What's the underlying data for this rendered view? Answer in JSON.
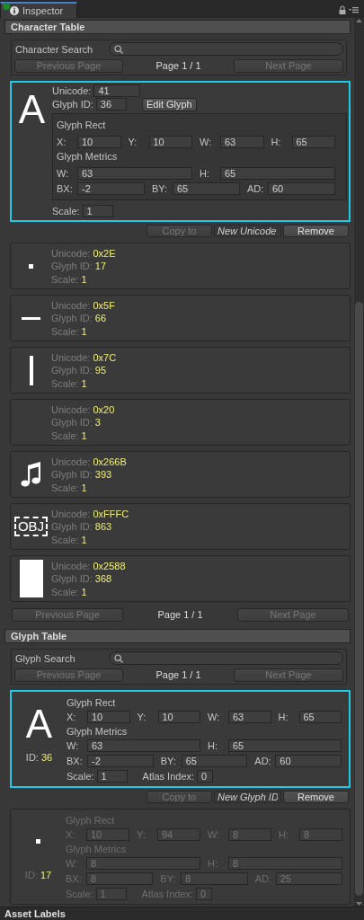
{
  "window": {
    "tab": {
      "label": "Inspector",
      "selected": true
    }
  },
  "character_table": {
    "title": "Character Table",
    "search": {
      "label": "Character Search"
    },
    "pager_top": {
      "previous": {
        "label": "Previous Page",
        "disabled": true
      },
      "page": "Page 1 / 1",
      "next": {
        "label": "Next Page",
        "disabled": true
      }
    },
    "characters": [
      {
        "selected": true,
        "preview": {
          "kind": "text",
          "text": "A"
        },
        "unicode_label": "Unicode:",
        "unicode": "41",
        "glyph_id_label": "Glyph ID:",
        "glyph_id": "36",
        "edit_button": "Edit Glyph",
        "glyph_rect": {
          "title": "Glyph Rect",
          "fields": [
            {
              "label": "X:",
              "value": "10"
            },
            {
              "label": "Y:",
              "value": "10"
            },
            {
              "label": "W:",
              "value": "63"
            },
            {
              "label": "H:",
              "value": "65"
            }
          ]
        },
        "glyph_metrics": {
          "title": "Glyph Metrics",
          "rows": [
            [
              {
                "label": "W:",
                "value": "63"
              },
              {
                "label": "H:",
                "value": "65"
              }
            ],
            [
              {
                "label": "BX:",
                "value": "-2"
              },
              {
                "label": "BY:",
                "value": "65"
              },
              {
                "label": "AD:",
                "value": "60"
              }
            ]
          ]
        },
        "scale_label": "Scale:",
        "scale": "1"
      },
      {
        "selected": false,
        "preview": {
          "kind": "dot"
        },
        "unicode_label": "Unicode:",
        "unicode": "0x2E",
        "glyph_id_label": "Glyph ID:",
        "glyph_id": "17",
        "scale_label": "Scale:",
        "scale": "1"
      },
      {
        "selected": false,
        "preview": {
          "kind": "underscore"
        },
        "unicode_label": "Unicode:",
        "unicode": "0x5F",
        "glyph_id_label": "Glyph ID:",
        "glyph_id": "66",
        "scale_label": "Scale:",
        "scale": "1"
      },
      {
        "selected": false,
        "preview": {
          "kind": "bar"
        },
        "unicode_label": "Unicode:",
        "unicode": "0x7C",
        "glyph_id_label": "Glyph ID:",
        "glyph_id": "95",
        "scale_label": "Scale:",
        "scale": "1"
      },
      {
        "selected": false,
        "preview": {
          "kind": "space"
        },
        "unicode_label": "Unicode:",
        "unicode": "0x20",
        "glyph_id_label": "Glyph ID:",
        "glyph_id": "3",
        "scale_label": "Scale:",
        "scale": "1"
      },
      {
        "selected": false,
        "preview": {
          "kind": "note"
        },
        "unicode_label": "Unicode:",
        "unicode": "0x266B",
        "glyph_id_label": "Glyph ID:",
        "glyph_id": "393",
        "scale_label": "Scale:",
        "scale": "1"
      },
      {
        "selected": false,
        "preview": {
          "kind": "object_box",
          "text": "OBJ"
        },
        "unicode_label": "Unicode:",
        "unicode": "0xFFFC",
        "glyph_id_label": "Glyph ID:",
        "glyph_id": "863",
        "scale_label": "Scale:",
        "scale": "1"
      },
      {
        "selected": false,
        "preview": {
          "kind": "block"
        },
        "unicode_label": "Unicode:",
        "unicode": "0x2588",
        "glyph_id_label": "Glyph ID:",
        "glyph_id": "368",
        "scale_label": "Scale:",
        "scale": "1"
      }
    ],
    "copy_row": {
      "copy": {
        "label": "Copy to",
        "disabled": true
      },
      "placeholder": "New Unicode",
      "remove": {
        "label": "Remove",
        "disabled": false
      }
    },
    "pager_bottom": {
      "previous": {
        "label": "Previous Page",
        "disabled": true
      },
      "page": "Page 1 / 1",
      "next": {
        "label": "Next Page",
        "disabled": true
      }
    }
  },
  "glyph_table": {
    "title": "Glyph Table",
    "search": {
      "label": "Glyph Search"
    },
    "pager": {
      "previous": {
        "label": "Previous Page",
        "disabled": true
      },
      "page": "Page 1 / 1",
      "next": {
        "label": "Next Page",
        "disabled": true
      }
    },
    "glyphs": [
      {
        "selected": true,
        "preview": {
          "kind": "text",
          "text": "A"
        },
        "id_label": "ID:",
        "id": "36",
        "glyph_rect": {
          "title": "Glyph Rect",
          "fields": [
            {
              "label": "X:",
              "value": "10"
            },
            {
              "label": "Y:",
              "value": "10"
            },
            {
              "label": "W:",
              "value": "63"
            },
            {
              "label": "H:",
              "value": "65"
            }
          ]
        },
        "glyph_metrics": {
          "title": "Glyph Metrics",
          "rows": [
            [
              {
                "label": "W:",
                "value": "63"
              },
              {
                "label": "H:",
                "value": "65"
              }
            ],
            [
              {
                "label": "BX:",
                "value": "-2"
              },
              {
                "label": "BY:",
                "value": "65"
              },
              {
                "label": "AD:",
                "value": "60"
              }
            ]
          ]
        },
        "scale_label": "Scale:",
        "scale": "1",
        "atlas_label": "Atlas Index:",
        "atlas_index": "0"
      },
      {
        "selected": false,
        "preview": {
          "kind": "dot"
        },
        "id_label": "ID:",
        "id": "17",
        "glyph_rect": {
          "title": "Glyph Rect",
          "fields": [
            {
              "label": "X:",
              "value": "10"
            },
            {
              "label": "Y:",
              "value": "94"
            },
            {
              "label": "W:",
              "value": "8"
            },
            {
              "label": "H:",
              "value": "8"
            }
          ]
        },
        "glyph_metrics": {
          "title": "Glyph Metrics",
          "rows": [
            [
              {
                "label": "W:",
                "value": "8"
              },
              {
                "label": "H:",
                "value": "8"
              }
            ],
            [
              {
                "label": "BX:",
                "value": "8"
              },
              {
                "label": "BY:",
                "value": "8"
              },
              {
                "label": "AD:",
                "value": "25"
              }
            ]
          ]
        },
        "scale_label": "Scale:",
        "scale": "1",
        "atlas_label": "Atlas Index:",
        "atlas_index": "0"
      }
    ],
    "copy_row": {
      "copy": {
        "label": "Copy to",
        "disabled": true
      },
      "placeholder": "New Glyph ID",
      "remove": {
        "label": "Remove",
        "disabled": false
      }
    }
  },
  "footer": {
    "title": "Asset Labels"
  }
}
